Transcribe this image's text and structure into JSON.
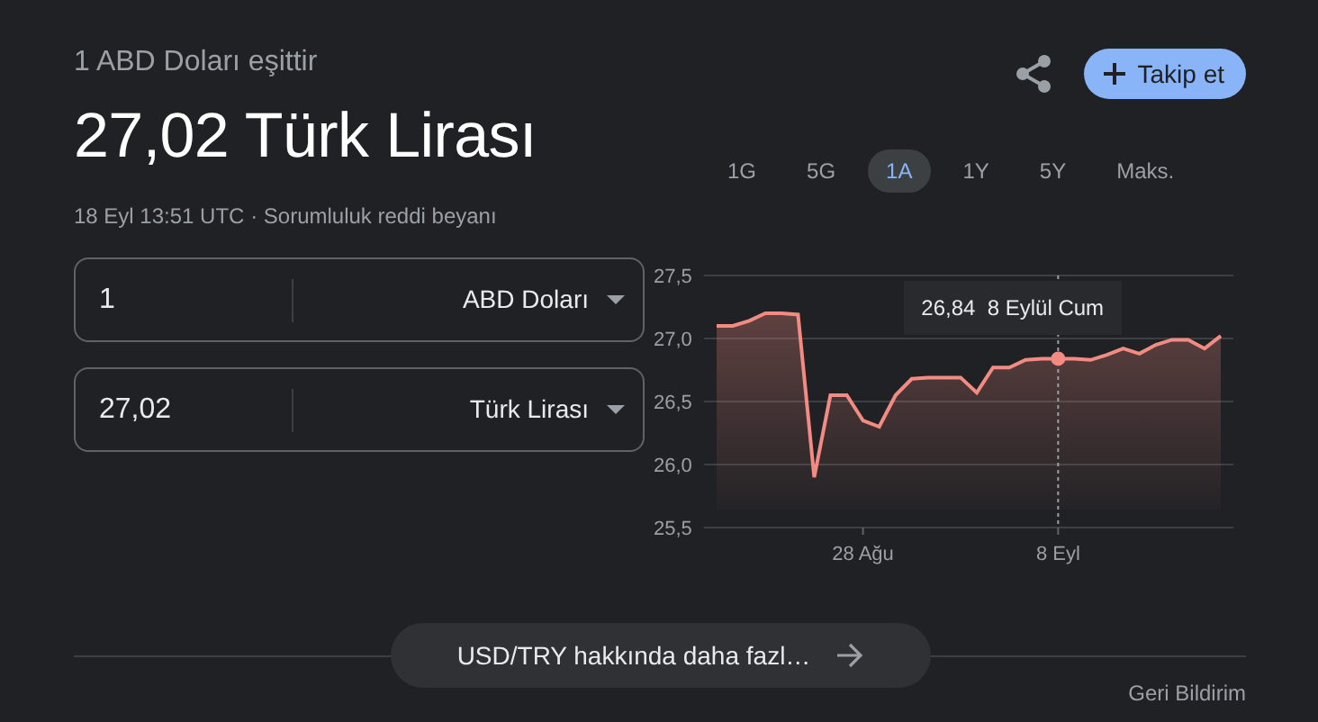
{
  "header": {
    "subtitle": "1 ABD Doları eşittir",
    "result": "27,02 Türk Lirası",
    "timestamp": "18 Eyl 13:51 UTC",
    "separator": "·",
    "disclaimer_link": "Sorumluluk reddi beyanı"
  },
  "actions": {
    "follow_button": "Takip et"
  },
  "ranges": [
    {
      "label": "1G",
      "selected": false
    },
    {
      "label": "5G",
      "selected": false
    },
    {
      "label": "1A",
      "selected": true
    },
    {
      "label": "1Y",
      "selected": false
    },
    {
      "label": "5Y",
      "selected": false
    },
    {
      "label": "Maks.",
      "selected": false
    }
  ],
  "converter": [
    {
      "value": "1",
      "currency": "ABD Doları"
    },
    {
      "value": "27,02",
      "currency": "Türk Lirası"
    }
  ],
  "chart": {
    "chart_data": {
      "type": "area",
      "categories": [
        null,
        null,
        null,
        null,
        null,
        null,
        null,
        null,
        null,
        "28 Ağu",
        null,
        null,
        null,
        null,
        null,
        null,
        null,
        null,
        null,
        null,
        null,
        "8 Eyl",
        null,
        null,
        null,
        null,
        null,
        null,
        null,
        null,
        null,
        null
      ],
      "series": [
        {
          "color": "#f28b82",
          "values": [
            27.1,
            27.1,
            27.14,
            27.2,
            27.2,
            27.19,
            25.9,
            26.55,
            26.55,
            26.35,
            26.3,
            26.55,
            26.68,
            26.69,
            26.69,
            26.69,
            26.57,
            26.77,
            26.77,
            26.83,
            26.84,
            26.84,
            26.84,
            26.83,
            26.87,
            26.92,
            26.88,
            26.95,
            26.99,
            26.99,
            26.92,
            27.02
          ]
        }
      ],
      "ylim": [
        25.5,
        27.5
      ],
      "grid": true,
      "yticks": [
        {
          "value": 27.5,
          "label": "27,5"
        },
        {
          "value": 27.0,
          "label": "27,0"
        },
        {
          "value": 26.5,
          "label": "26,5"
        },
        {
          "value": 26.0,
          "label": "26,0"
        },
        {
          "value": 25.5,
          "label": "25,5"
        }
      ],
      "annotations": [
        {
          "x": "8 Eyl",
          "y": 26.84,
          "text": "26,84  8 Eylül Cum"
        }
      ]
    }
  },
  "more_button": "USD/TRY hakkında daha fazl…",
  "feedback": "Geri Bildirim"
}
